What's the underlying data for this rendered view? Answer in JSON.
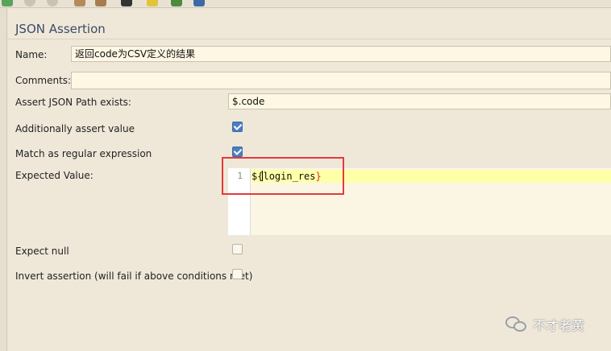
{
  "panel": {
    "title": "JSON Assertion"
  },
  "fields": {
    "name_label": "Name:",
    "name_value": "返回code为CSV定义的结果",
    "comments_label": "Comments:",
    "comments_value": "",
    "json_path_label": "Assert JSON Path exists:",
    "json_path_value": "$.code",
    "additionally_assert_label": "Additionally assert value",
    "additionally_assert_checked": true,
    "regex_label": "Match as regular expression",
    "regex_checked": true,
    "expected_value_label": "Expected Value:",
    "expect_null_label": "Expect null",
    "expect_null_checked": false,
    "invert_label": "Invert assertion (will fail if above conditions met)",
    "invert_checked": false
  },
  "editor": {
    "line_number": "1",
    "prefix": "$",
    "open_brace": "{",
    "variable": "login_res",
    "close_brace": "}"
  },
  "watermark": {
    "text": "不才老黄"
  },
  "colors": {
    "background": "#efe8d9",
    "field_background": "#fdf7e3",
    "checkbox_checked": "#4a7fc1",
    "highlight_box": "#e23b3b",
    "current_line": "#ffffa8"
  }
}
